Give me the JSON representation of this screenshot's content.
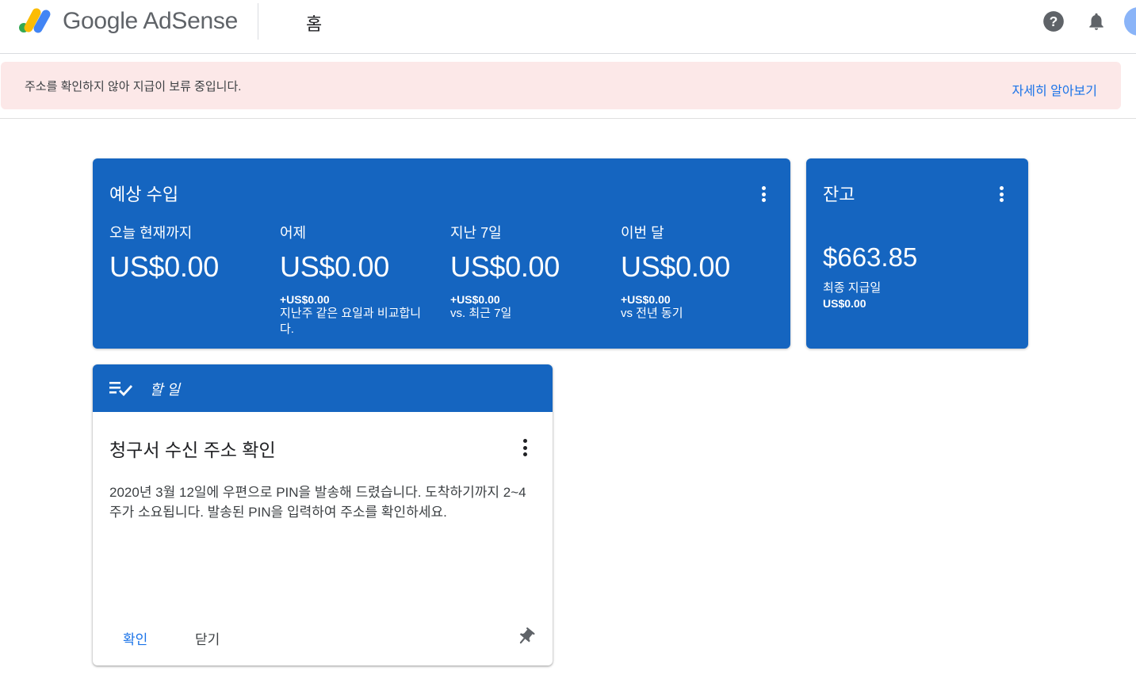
{
  "header": {
    "logo_text": "Google AdSense",
    "page_title": "홈"
  },
  "banner": {
    "message": "주소를 확인하지 않아 지급이 보류 중입니다.",
    "link_label": "자세히 알아보기"
  },
  "earnings": {
    "title": "예상 수입",
    "metrics": [
      {
        "label": "오늘 현재까지",
        "value": "US$0.00",
        "delta": "",
        "note": ""
      },
      {
        "label": "어제",
        "value": "US$0.00",
        "delta": "+US$0.00",
        "note": "지난주 같은 요일과 비교합니다."
      },
      {
        "label": "지난 7일",
        "value": "US$0.00",
        "delta": "+US$0.00",
        "note": "vs. 최근 7일"
      },
      {
        "label": "이번 달",
        "value": "US$0.00",
        "delta": "+US$0.00",
        "note": "vs 전년 동기"
      }
    ]
  },
  "balance": {
    "title": "잔고",
    "value": "$663.85",
    "sub_label": "최종 지급일",
    "sub_value": "US$0.00"
  },
  "todo": {
    "header_label": "할 일",
    "title": "청구서 수신 주소 확인",
    "body": "2020년 3월 12일에 우편으로 PIN을 발송해 드렸습니다. 도착하기까지 2~4주가 소요됩니다. 발송된 PIN을 입력하여 주소를 확인하세요.",
    "confirm_label": "확인",
    "close_label": "닫기"
  },
  "colors": {
    "card_blue": "#1565c0",
    "banner_bg": "#fce8e8",
    "link_blue": "#1a73e8"
  },
  "icons": {
    "logo": "adsense-logo-icon",
    "help": "help-icon",
    "notifications": "bell-icon",
    "todo": "checklist-icon",
    "pin": "pin-icon",
    "menu": "more-vert-icon"
  }
}
